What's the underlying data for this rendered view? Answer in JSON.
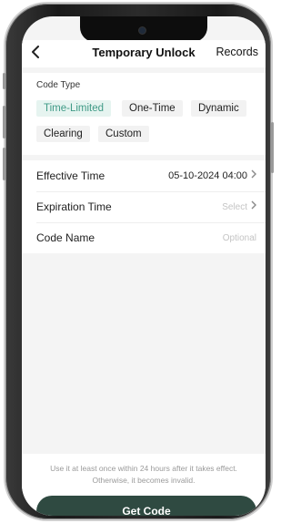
{
  "header": {
    "back_icon": "chevron-left-icon",
    "title": "Temporary Unlock",
    "records_label": "Records"
  },
  "code_type": {
    "label": "Code Type",
    "options": [
      "Time-Limited",
      "One-Time",
      "Dynamic",
      "Clearing",
      "Custom"
    ],
    "selected": "Time-Limited"
  },
  "fields": {
    "effective_time": {
      "label": "Effective Time",
      "value": "05-10-2024 04:00"
    },
    "expiration_time": {
      "label": "Expiration Time",
      "placeholder": "Select"
    },
    "code_name": {
      "label": "Code Name",
      "placeholder": "Optional"
    }
  },
  "footer": {
    "note_line1": "Use it at least once within 24 hours after it takes effect.",
    "note_line2": "Otherwise, it becomes invalid.",
    "button_label": "Get Code"
  },
  "colors": {
    "accent": "#3f9a86",
    "accent_bg": "#e6f4f0",
    "button": "#2f4a41",
    "background": "#f4f4f4"
  }
}
